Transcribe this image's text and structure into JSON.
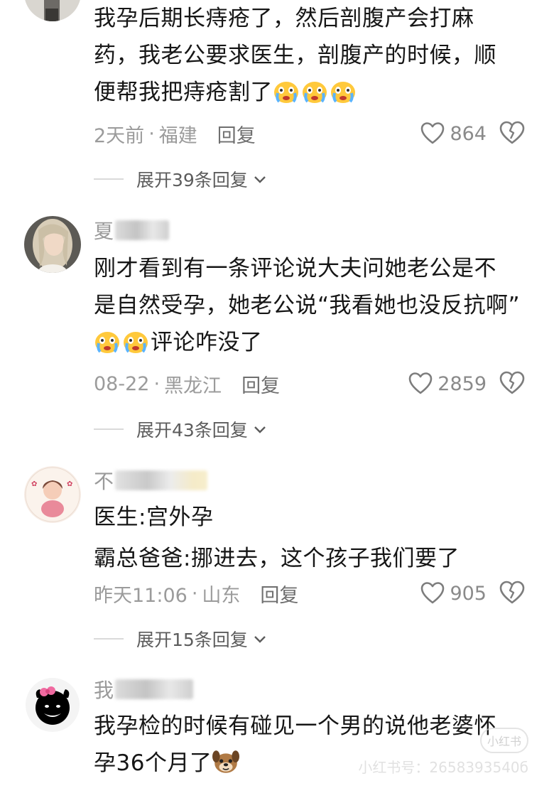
{
  "comments": [
    {
      "text_lines": [
        "我孕后期长痔疮了，然后剖腹产会打麻",
        "药，我老公要求医生，剖腹产的时候，顺",
        "便帮我把痔疮割了"
      ],
      "time": "2天前",
      "location": "福建",
      "reply_label": "回复",
      "likes": "864",
      "expand_label": "展开39条回复"
    },
    {
      "username_visible": "夏",
      "text_lines": [
        "刚才看到有一条评论说大夫问她老公是不",
        "是自然受孕，她老公说“我看她也没反抗啊”",
        "评论咋没了"
      ],
      "time": "08-22",
      "location": "黑龙江",
      "reply_label": "回复",
      "likes": "2859",
      "expand_label": "展开43条回复"
    },
    {
      "username_visible": "不",
      "text_lines": [
        "医生:宫外孕",
        "霸总爸爸:挪进去，这个孩子我们要了"
      ],
      "time": "昨天11:06",
      "location": "山东",
      "reply_label": "回复",
      "likes": "905",
      "expand_label": "展开15条回复"
    },
    {
      "username_visible": "我",
      "text_lines": [
        "我孕检的时候有碰见一个男的说他老婆怀",
        "孕36个月了"
      ]
    }
  ],
  "meta_separator": "·",
  "watermark": {
    "logo": "小红书",
    "text": "小红书号：2658393540б"
  },
  "icons": {
    "like": "heart-outline-icon",
    "dislike": "broken-heart-icon",
    "expand": "chevron-down-icon",
    "emoji_cry": "crying-face-emoji",
    "emoji_dog": "dog-face-emoji"
  },
  "colors": {
    "text": "#161616",
    "meta": "#9b9b9b",
    "icon": "#8a8a8a"
  }
}
